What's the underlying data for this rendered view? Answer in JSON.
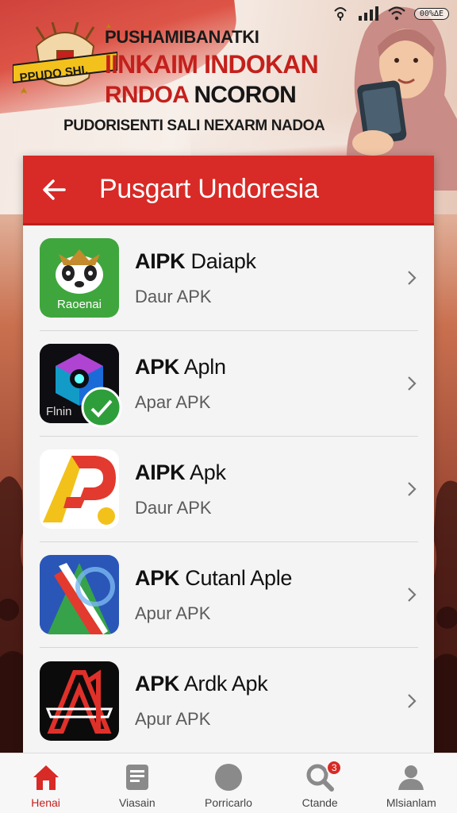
{
  "status_bar": {
    "battery_text": "00%∆E"
  },
  "banner": {
    "emblem_text": "PPUDO SHI.",
    "line1": "PUSHAMIBANATKI",
    "line2": "IINKAIM INDOKAN",
    "line3_red": "RNDOA",
    "line3_dark": "NCORON",
    "line4": "PUDORISENTI SALI NEXARM NADOA"
  },
  "header": {
    "title": "Pusgart Undoresia"
  },
  "apps": [
    {
      "name_bold": "AIPK",
      "name_rest": " Daiapk",
      "subtitle": "Daur APK",
      "icon": "bear-face-icon",
      "icon_text": "Raoenai"
    },
    {
      "name_bold": "APK",
      "name_rest": " Apln",
      "subtitle": "Apar APK",
      "icon": "hexagon-eye-icon",
      "icon_text": "Flnin"
    },
    {
      "name_bold": "AIPK",
      "name_rest": " Apk",
      "subtitle": "Daur APK",
      "icon": "red-yellow-a-icon",
      "icon_text": ""
    },
    {
      "name_bold": "APK",
      "name_rest": " Cutanl Aple",
      "subtitle": "Apur APK",
      "icon": "triangle-a-icon",
      "icon_text": ""
    },
    {
      "name_bold": "APK",
      "name_rest": " Ardk Apk",
      "subtitle": "Apur APK",
      "icon": "red-a1-icon",
      "icon_text": ""
    }
  ],
  "nav": {
    "items": [
      {
        "label": "Henai",
        "icon": "home-icon",
        "active": true
      },
      {
        "label": "Viasain",
        "icon": "document-icon",
        "active": false
      },
      {
        "label": "Porricarlo",
        "icon": "compass-icon",
        "active": false
      },
      {
        "label": "Ctande",
        "icon": "search-icon",
        "active": false,
        "badge": "3"
      },
      {
        "label": "Mlsianlam",
        "icon": "user-icon",
        "active": false
      }
    ]
  },
  "colors": {
    "primary_red": "#d82a26",
    "active_nav": "#c4201c"
  }
}
